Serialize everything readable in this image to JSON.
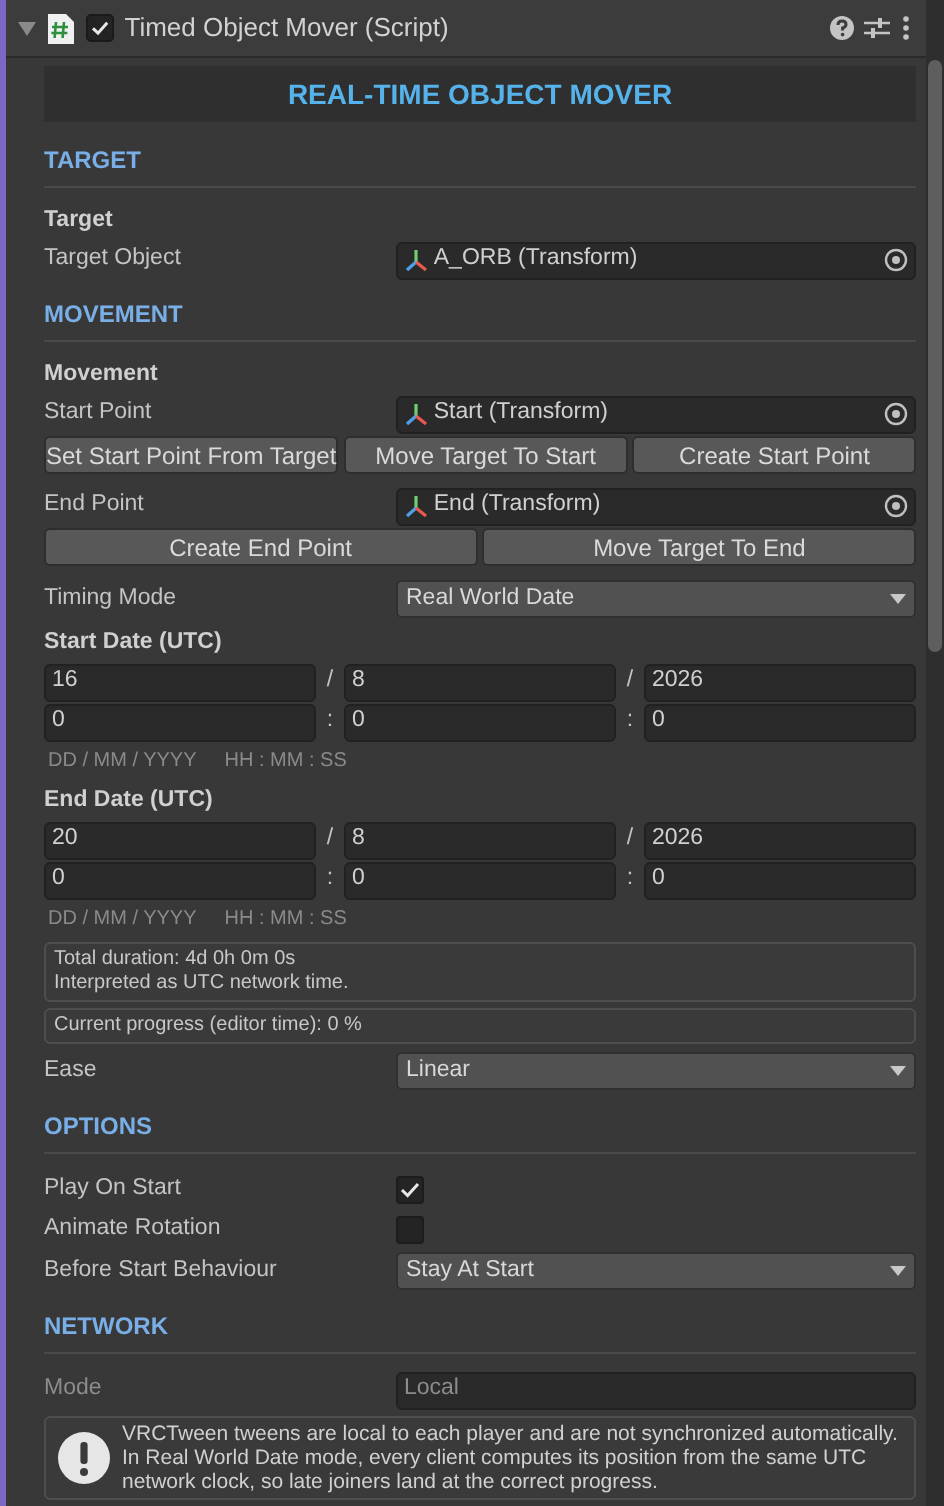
{
  "header": {
    "title": "Timed Object Mover (Script)",
    "expanded": true,
    "enabled": true
  },
  "banner": "REAL-TIME OBJECT MOVER",
  "sections": [
    {
      "heading": "TARGET",
      "rows": [
        {
          "kind": "subheading",
          "label": "Target"
        },
        {
          "kind": "object",
          "label": "Target Object",
          "value": "A_ORB (Transform)"
        }
      ]
    },
    {
      "heading": "MOVEMENT",
      "rows": [
        {
          "kind": "subheading",
          "label": "Movement"
        },
        {
          "kind": "object",
          "label": "Start Point",
          "value": "Start (Transform)"
        },
        {
          "kind": "buttons",
          "buttons": [
            "Set Start Point From Target",
            "Move Target To Start",
            "Create Start Point"
          ]
        },
        {
          "kind": "object",
          "label": "End Point",
          "value": "End (Transform)"
        },
        {
          "kind": "buttons",
          "buttons": [
            "Create End Point",
            "Move Target To End"
          ]
        },
        {
          "kind": "dropdown",
          "label": "Timing Mode",
          "value": "Real World Date"
        },
        {
          "kind": "date",
          "label": "Start Date  (UTC)",
          "date": [
            "16",
            "8",
            "2026"
          ],
          "time": [
            "0",
            "0",
            "0"
          ],
          "date_sep": [
            "/",
            "/"
          ],
          "time_sep": [
            ":",
            ":"
          ],
          "hints": [
            "DD / MM / YYYY",
            "HH : MM : SS"
          ]
        },
        {
          "kind": "date",
          "label": "End Date  (UTC)",
          "date": [
            "20",
            "8",
            "2026"
          ],
          "time": [
            "0",
            "0",
            "0"
          ],
          "date_sep": [
            "/",
            "/"
          ],
          "time_sep": [
            ":",
            ":"
          ],
          "hints": [
            "DD / MM / YYYY",
            "HH : MM : SS"
          ]
        },
        {
          "kind": "info",
          "lines": [
            "Total duration: 4d 0h 0m 0s",
            "Interpreted as UTC network time."
          ]
        },
        {
          "kind": "info",
          "lines": [
            "Current progress (editor time): 0 %"
          ]
        },
        {
          "kind": "dropdown",
          "label": "Ease",
          "value": "Linear"
        }
      ]
    },
    {
      "heading": "OPTIONS",
      "rows": [
        {
          "kind": "checkbox",
          "label": "Play On Start",
          "checked": true
        },
        {
          "kind": "checkbox",
          "label": "Animate Rotation",
          "checked": false
        },
        {
          "kind": "dropdown",
          "label": "Before Start Behaviour",
          "value": "Stay At Start"
        }
      ]
    },
    {
      "heading": "NETWORK",
      "rows": [
        {
          "kind": "readonly",
          "label": "Mode",
          "value": "Local",
          "disabled": true
        },
        {
          "kind": "help",
          "text": "VRCTween tweens are local to each player and are not synchronized automatically. In Real World Date mode, every client computes its position from the same UTC network clock, so late joiners land at the correct progress."
        }
      ]
    }
  ]
}
